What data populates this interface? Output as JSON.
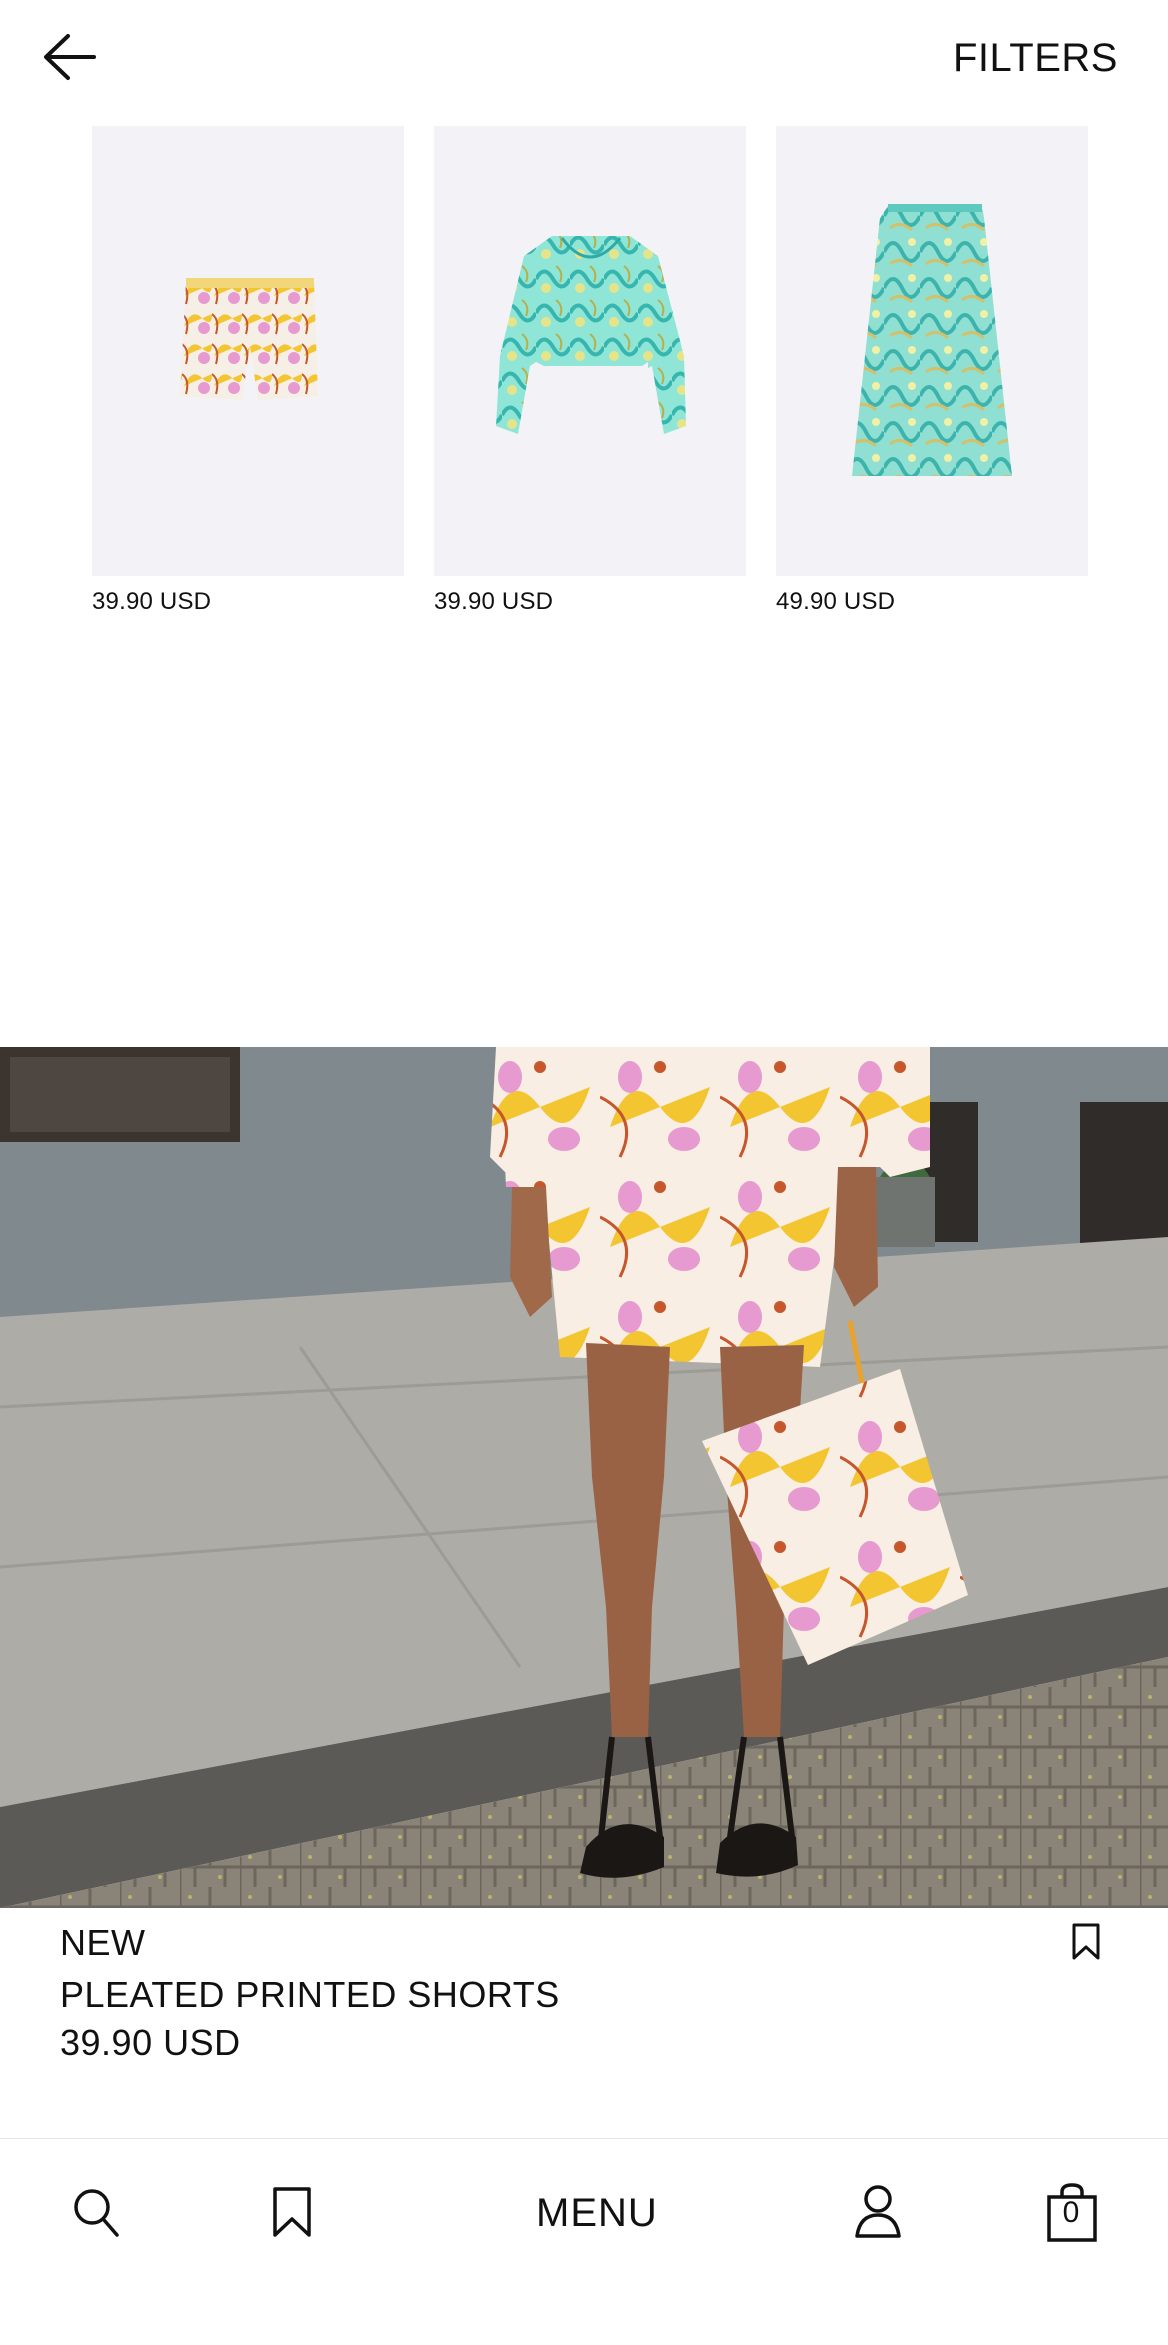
{
  "header": {
    "back_icon": "arrow-left-icon",
    "filters_label": "FILTERS"
  },
  "products": [
    {
      "price": "39.90 USD",
      "image": "printed-shorts"
    },
    {
      "price": "39.90 USD",
      "image": "printed-crop-blouse"
    },
    {
      "price": "49.90 USD",
      "image": "printed-midi-skirt"
    }
  ],
  "featured": {
    "badge": "NEW",
    "name": "PLEATED PRINTED SHORTS",
    "price": "39.90 USD",
    "bookmark_icon": "bookmark-icon"
  },
  "bottom_nav": {
    "search_icon": "search-icon",
    "saved_icon": "bookmark-icon",
    "menu_label": "MENU",
    "account_icon": "user-icon",
    "bag_icon": "shopping-bag-icon",
    "bag_count": "0"
  },
  "colors": {
    "text": "#111111",
    "thumb_bg": "#f3f2f6",
    "print_yellow": "#f2c531",
    "print_pink": "#e79ad0",
    "print_teal": "#4fd1c4"
  }
}
